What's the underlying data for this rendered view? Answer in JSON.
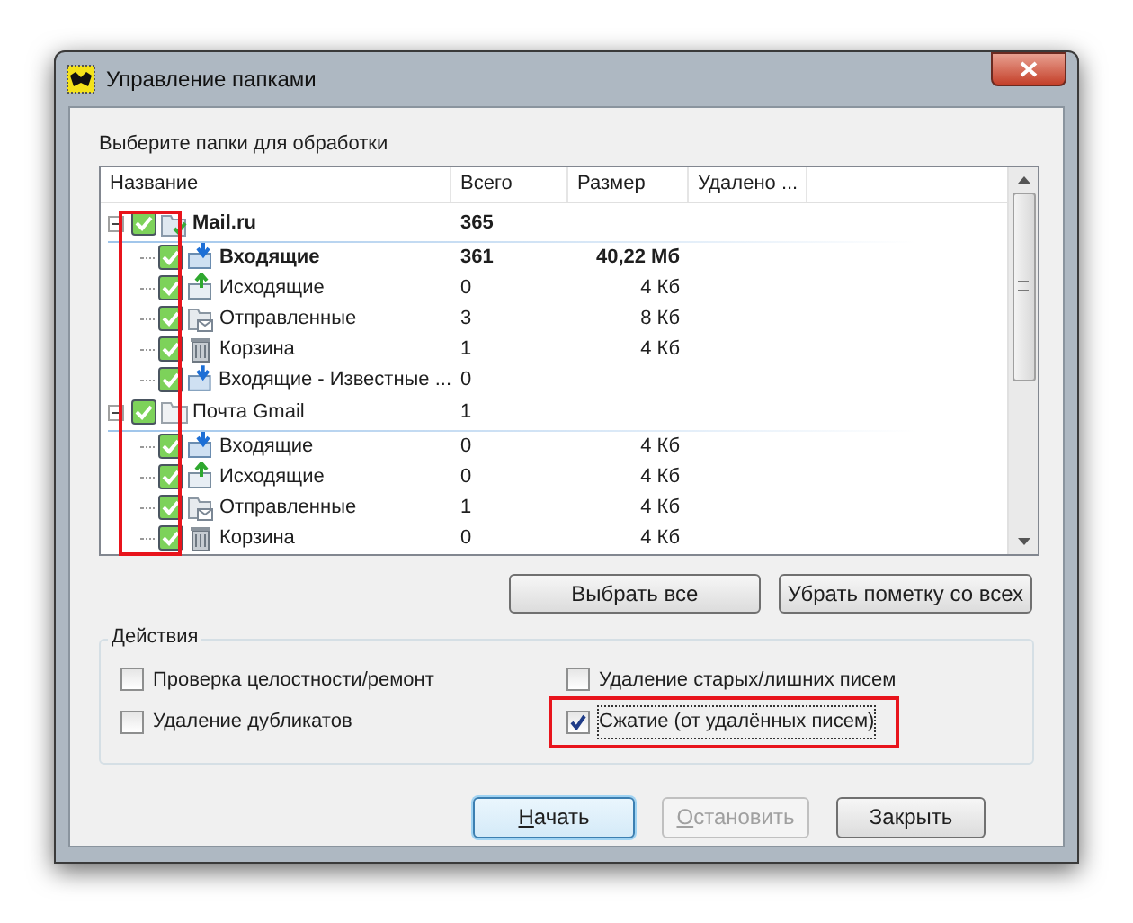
{
  "window": {
    "title": "Управление папками"
  },
  "folders": {
    "label": "Выберите папки для обработки",
    "checkbox_column_highlighted": true,
    "columns": [
      "Название",
      "Всего",
      "Размер",
      "Удалено ..."
    ],
    "tree": [
      {
        "name": "Mail.ru",
        "total": "365",
        "bold": true,
        "checked": true,
        "expanded": true,
        "kind": "account",
        "children": [
          {
            "name": "Входящие",
            "total": "361",
            "size": "40,22 Мб",
            "bold": true,
            "checked": true,
            "kind": "inbox"
          },
          {
            "name": "Исходящие",
            "total": "0",
            "size": "4 Кб",
            "bold": false,
            "checked": true,
            "kind": "outbox"
          },
          {
            "name": "Отправленные",
            "total": "3",
            "size": "8 Кб",
            "bold": false,
            "checked": true,
            "kind": "sent"
          },
          {
            "name": "Корзина",
            "total": "1",
            "size": "4 Кб",
            "bold": false,
            "checked": true,
            "kind": "trash"
          },
          {
            "name": "Входящие - Известные ...",
            "total": "0",
            "bold": false,
            "checked": true,
            "kind": "inbox"
          }
        ]
      },
      {
        "name": "Почта Gmail",
        "total": "1",
        "bold": false,
        "checked": true,
        "expanded": true,
        "kind": "folder",
        "children": [
          {
            "name": "Входящие",
            "total": "0",
            "size": "4 Кб",
            "bold": false,
            "checked": true,
            "kind": "inbox"
          },
          {
            "name": "Исходящие",
            "total": "0",
            "size": "4 Кб",
            "bold": false,
            "checked": true,
            "kind": "outbox"
          },
          {
            "name": "Отправленные",
            "total": "1",
            "size": "4 Кб",
            "bold": false,
            "checked": true,
            "kind": "sent"
          },
          {
            "name": "Корзина",
            "total": "0",
            "size": "4 Кб",
            "bold": false,
            "checked": true,
            "kind": "trash"
          }
        ]
      }
    ]
  },
  "selection_buttons": [
    "Выбрать все",
    "Убрать пометку со всех"
  ],
  "actions": {
    "label": "Действия",
    "items": [
      {
        "label": "Проверка целостности/ремонт",
        "checked": false,
        "highlighted": false
      },
      {
        "label": "Удаление старых/лишних писем",
        "checked": false,
        "highlighted": false
      },
      {
        "label": "Удаление дубликатов",
        "checked": false,
        "highlighted": false
      },
      {
        "label": "Сжатие (от удалённых писем)",
        "checked": true,
        "highlighted": true
      }
    ]
  },
  "buttons": [
    {
      "label": "Начать",
      "default": true,
      "disabled": false,
      "mnemonic_first": true
    },
    {
      "label": "Остановить",
      "default": false,
      "disabled": true,
      "mnemonic_first": true
    },
    {
      "label": "Закрыть",
      "default": false,
      "disabled": false,
      "mnemonic_first": false
    }
  ]
}
